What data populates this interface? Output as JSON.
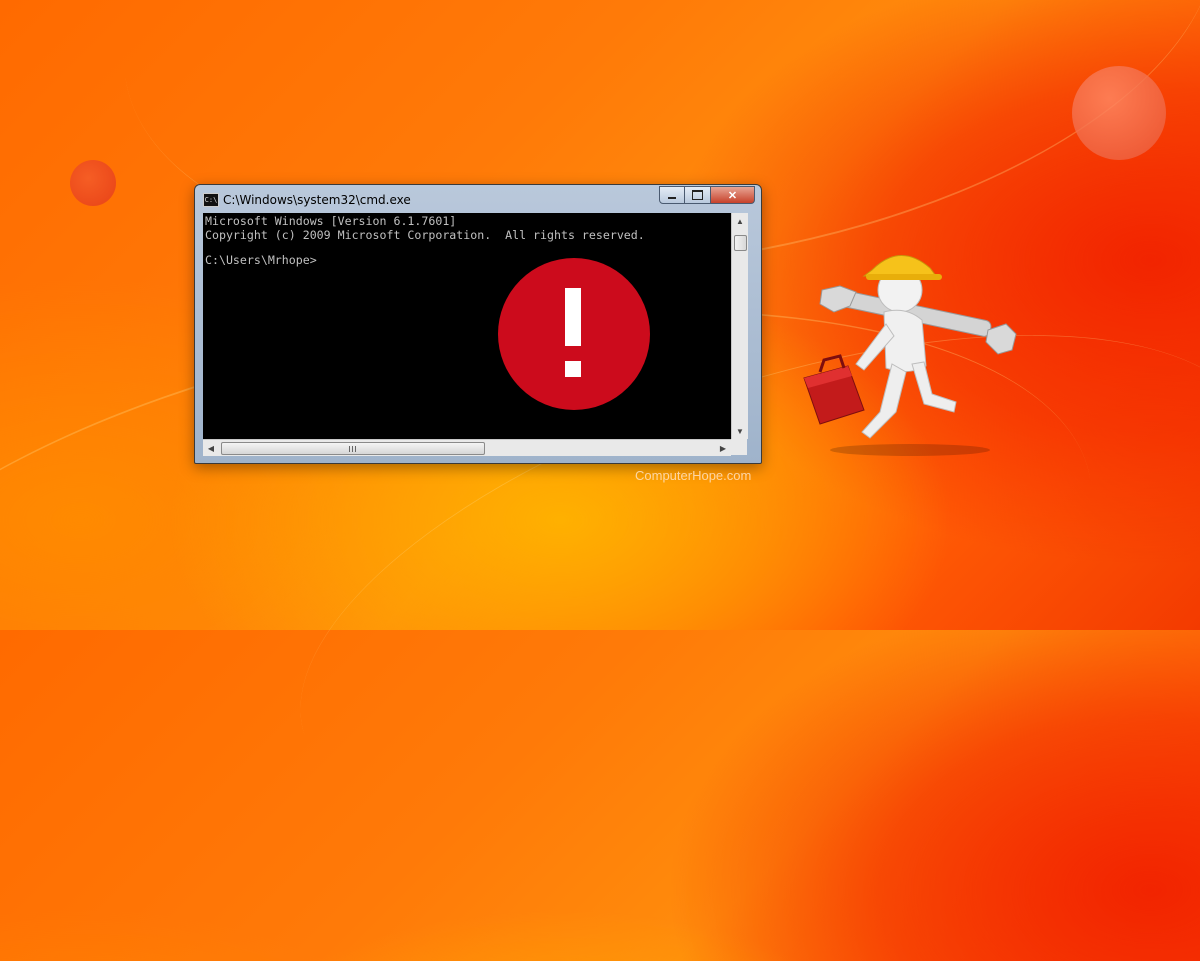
{
  "window": {
    "title": "C:\\Windows\\system32\\cmd.exe",
    "icon_label": "C:\\",
    "controls": {
      "minimize": "minimize",
      "maximize": "maximize",
      "close": "✕"
    }
  },
  "console": {
    "lines": [
      "Microsoft Windows [Version 6.1.7601]",
      "Copyright (c) 2009 Microsoft Corporation.  All rights reserved.",
      "C:\\Users\\Mrhope>"
    ],
    "text_color": "#c0c0c0",
    "background_color": "#000000"
  },
  "error_badge": {
    "icon": "exclamation-icon",
    "color": "#cc0b1c"
  },
  "mascot": {
    "icon": "repairman-with-wrench-and-toolbox"
  },
  "watermark": "ComputerHope.com",
  "colors": {
    "background_primary": "#ff7a08",
    "background_accent": "#f22400"
  }
}
